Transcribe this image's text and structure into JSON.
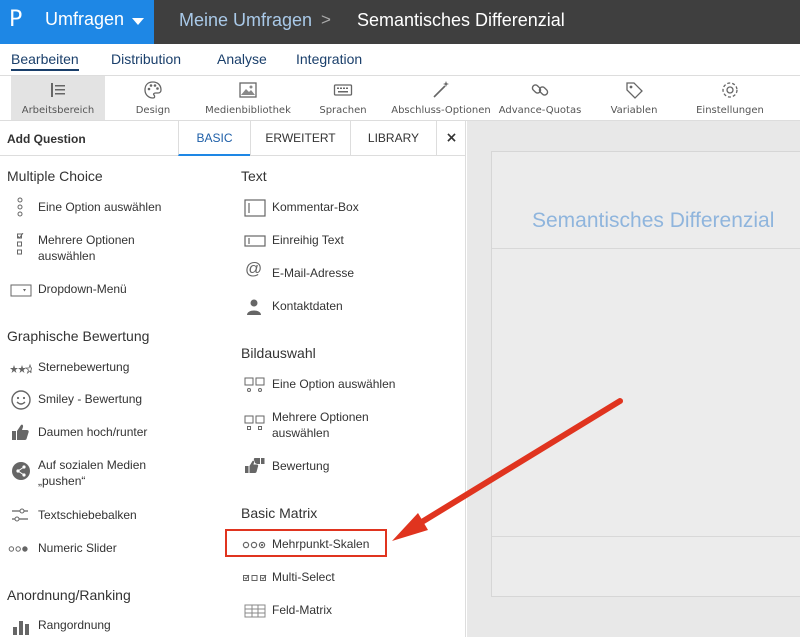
{
  "header": {
    "logo_glyph": "P",
    "product": "Umfragen",
    "breadcrumb_parent": "Meine Umfragen",
    "breadcrumb_sep": ">",
    "breadcrumb_current": "Semantisches Differenzial"
  },
  "nav": {
    "tabs": [
      "Bearbeiten",
      "Distribution",
      "Analyse",
      "Integration"
    ],
    "active": "Bearbeiten"
  },
  "toolbar": {
    "items": [
      {
        "label": "Arbeitsbereich",
        "icon": "workspace-icon"
      },
      {
        "label": "Design",
        "icon": "palette-icon"
      },
      {
        "label": "Medienbibliothek",
        "icon": "image-icon"
      },
      {
        "label": "Sprachen",
        "icon": "keyboard-icon"
      },
      {
        "label": "Abschluss-Optionen",
        "icon": "magic-wand-icon"
      },
      {
        "label": "Advance-Quotas",
        "icon": "link-icon"
      },
      {
        "label": "Variablen",
        "icon": "tag-icon"
      },
      {
        "label": "Einstellungen",
        "icon": "gear-icon"
      }
    ]
  },
  "panel": {
    "title": "Add Question",
    "tabs": [
      "BASIC",
      "ERWEITERT",
      "LIBRARY"
    ],
    "close": "×",
    "left": [
      {
        "section": "Multiple Choice",
        "items": [
          {
            "label": "Eine Option auswählen",
            "icon": "radio-list-icon"
          },
          {
            "label": "Mehrere Optionen auswählen",
            "icon": "checkbox-list-icon"
          },
          {
            "label": "Dropdown-Menü",
            "icon": "dropdown-icon"
          }
        ]
      },
      {
        "section": "Graphische Bewertung",
        "items": [
          {
            "label": "Sternebewertung",
            "icon": "stars-icon"
          },
          {
            "label": "Smiley - Bewertung",
            "icon": "smiley-icon"
          },
          {
            "label": "Daumen hoch/runter",
            "icon": "thumbs-up-icon"
          },
          {
            "label": "Auf sozialen Medien „pushen“",
            "icon": "share-icon"
          },
          {
            "label": "Textschiebebalken",
            "icon": "sliders-icon"
          },
          {
            "label": "Numeric Slider",
            "icon": "numeric-slider-icon"
          }
        ]
      },
      {
        "section": "Anordnung/Ranking",
        "items": [
          {
            "label": "Rangordnung",
            "icon": "ranking-icon"
          }
        ]
      }
    ],
    "right": [
      {
        "section": "Text",
        "items": [
          {
            "label": "Kommentar-Box",
            "icon": "comment-box-icon"
          },
          {
            "label": "Einreihig Text",
            "icon": "single-line-text-icon"
          },
          {
            "label": "E-Mail-Adresse",
            "icon": "at-icon"
          },
          {
            "label": "Kontaktdaten",
            "icon": "contact-icon"
          }
        ]
      },
      {
        "section": "Bildauswahl",
        "items": [
          {
            "label": "Eine Option auswählen",
            "icon": "image-choice-icon"
          },
          {
            "label": "Mehrere Optionen auswählen",
            "icon": "image-multi-choice-icon"
          },
          {
            "label": "Bewertung",
            "icon": "thumbs-rating-icon"
          }
        ]
      },
      {
        "section": "Basic Matrix",
        "items": [
          {
            "label": "Mehrpunkt-Skalen",
            "icon": "multipoint-scale-icon"
          },
          {
            "label": "Multi-Select",
            "icon": "multi-select-icon"
          },
          {
            "label": "Feld-Matrix",
            "icon": "field-matrix-icon"
          }
        ]
      }
    ]
  },
  "canvas": {
    "survey_title": "Semantisches Differenzial"
  },
  "colors": {
    "accent": "#1e87e5",
    "topbar": "#3f3f3f",
    "highlight": "#e0341f"
  }
}
